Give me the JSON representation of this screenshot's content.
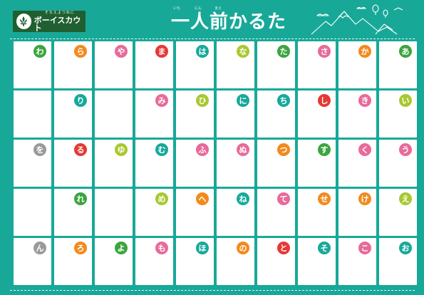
{
  "logo": {
    "tagline": "そなえよつねに",
    "name": "ボーイスカウト"
  },
  "title": {
    "text": "一人前かるた",
    "ruby": [
      {
        "text": "いち",
        "offset": 0
      },
      {
        "text": "にん",
        "offset": 1
      },
      {
        "text": "まえ",
        "offset": 2
      }
    ]
  },
  "colors": {
    "background": "#18a898",
    "logo_bg": "#1f5f30",
    "orange": "#f28a1e",
    "pink": "#e86a9a",
    "yellowgreen": "#a8c830",
    "green": "#3aa53f",
    "red": "#e53935",
    "teal": "#17a99a",
    "gray": "#9a9a9a"
  },
  "grid": {
    "rows": [
      [
        {
          "kana": "わ",
          "color": "#3aa53f"
        },
        {
          "kana": "ら",
          "color": "#f28a1e"
        },
        {
          "kana": "や",
          "color": "#e86a9a"
        },
        {
          "kana": "ま",
          "color": "#e53935"
        },
        {
          "kana": "は",
          "color": "#17a99a"
        },
        {
          "kana": "な",
          "color": "#a8c830"
        },
        {
          "kana": "た",
          "color": "#3aa53f"
        },
        {
          "kana": "さ",
          "color": "#e86a9a"
        },
        {
          "kana": "か",
          "color": "#f28a1e"
        },
        {
          "kana": "あ",
          "color": "#3aa53f"
        }
      ],
      [
        {
          "kana": "",
          "color": ""
        },
        {
          "kana": "り",
          "color": "#17a99a"
        },
        {
          "kana": "",
          "color": ""
        },
        {
          "kana": "み",
          "color": "#e86a9a"
        },
        {
          "kana": "ひ",
          "color": "#a8c830"
        },
        {
          "kana": "に",
          "color": "#17a99a"
        },
        {
          "kana": "ち",
          "color": "#17a99a"
        },
        {
          "kana": "し",
          "color": "#e53935"
        },
        {
          "kana": "き",
          "color": "#e86a9a"
        },
        {
          "kana": "い",
          "color": "#a8c830"
        }
      ],
      [
        {
          "kana": "を",
          "color": "#9a9a9a"
        },
        {
          "kana": "る",
          "color": "#e53935"
        },
        {
          "kana": "ゆ",
          "color": "#a8c830"
        },
        {
          "kana": "む",
          "color": "#17a99a"
        },
        {
          "kana": "ふ",
          "color": "#e86a9a"
        },
        {
          "kana": "ぬ",
          "color": "#e86a9a"
        },
        {
          "kana": "つ",
          "color": "#f28a1e"
        },
        {
          "kana": "す",
          "color": "#3aa53f"
        },
        {
          "kana": "く",
          "color": "#e86a9a"
        },
        {
          "kana": "う",
          "color": "#e86a9a"
        }
      ],
      [
        {
          "kana": "",
          "color": ""
        },
        {
          "kana": "れ",
          "color": "#3aa53f"
        },
        {
          "kana": "",
          "color": ""
        },
        {
          "kana": "め",
          "color": "#a8c830"
        },
        {
          "kana": "へ",
          "color": "#f28a1e"
        },
        {
          "kana": "ね",
          "color": "#17a99a"
        },
        {
          "kana": "て",
          "color": "#e86a9a"
        },
        {
          "kana": "せ",
          "color": "#f28a1e"
        },
        {
          "kana": "け",
          "color": "#f28a1e"
        },
        {
          "kana": "え",
          "color": "#a8c830"
        }
      ],
      [
        {
          "kana": "ん",
          "color": "#9a9a9a"
        },
        {
          "kana": "ろ",
          "color": "#f28a1e"
        },
        {
          "kana": "よ",
          "color": "#3aa53f"
        },
        {
          "kana": "も",
          "color": "#e86a9a"
        },
        {
          "kana": "ほ",
          "color": "#17a99a"
        },
        {
          "kana": "の",
          "color": "#f28a1e"
        },
        {
          "kana": "と",
          "color": "#e53935"
        },
        {
          "kana": "そ",
          "color": "#17a99a"
        },
        {
          "kana": "こ",
          "color": "#e86a9a"
        },
        {
          "kana": "お",
          "color": "#17a99a"
        }
      ]
    ]
  }
}
